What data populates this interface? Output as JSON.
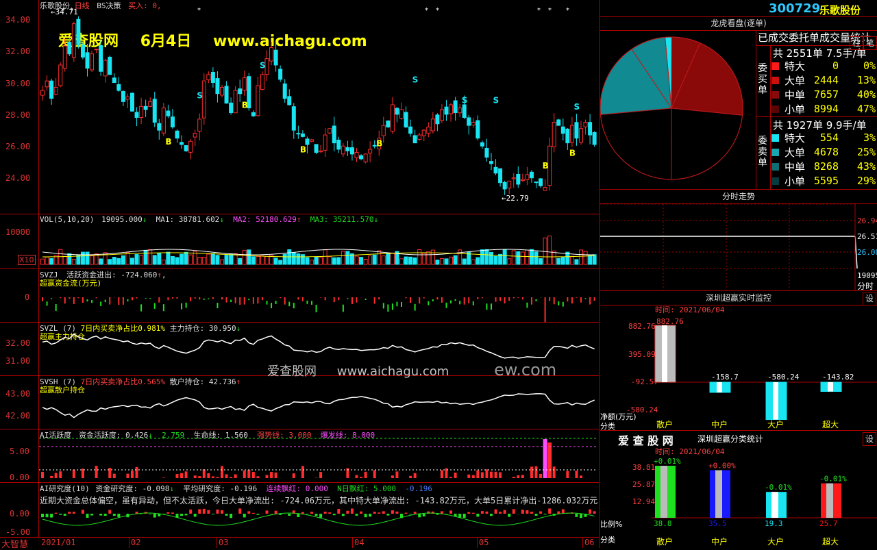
{
  "colors": {
    "up": "#ff2d2d",
    "down": "#18e4f2",
    "grid": "#a00000",
    "yellow": "#ffff00",
    "magenta": "#ff4dff",
    "green": "#1ee01e",
    "white": "#ffffff",
    "axisText": "#e03030"
  },
  "header": {
    "stock_name": "乐歌股份",
    "period": "日线",
    "strategy": "BS决策",
    "buy_label": "买入: 0,",
    "high_mark": "34.71",
    "low_mark": "22.79"
  },
  "watermark": {
    "site": "爱查股网",
    "date": "6月4日",
    "url": "www.aichagu.com",
    "center_site": "爱查股网",
    "center_url": "www.aichagu.com",
    "center_tail": "ew.com"
  },
  "price_axis": [
    "34.00",
    "32.00",
    "30.00",
    "28.00",
    "26.00",
    "24.00"
  ],
  "vol": {
    "label": "VOL(5,10,20)",
    "v": "19095.000",
    "ma1": "MA1: 38781.602",
    "ma2": "MA2: 52180.629",
    "ma3": "MA3: 35211.570",
    "axis": "10000",
    "unit": "X10"
  },
  "svzj": {
    "label": "SVZJ",
    "name": "活跃资金进出: -724.060",
    "sub": "超赢资金流(万元)",
    "axis": "0"
  },
  "svzl": {
    "label": "SVZL (7)",
    "pct": "7日内买卖净占比0.981%",
    "hold": "主力持仓: 30.950",
    "sub": "超赢主力持仓",
    "axis": [
      "32.00",
      "31.00"
    ]
  },
  "svsh": {
    "label": "SVSH (7)",
    "pct": "7日内买卖净占比0.565%",
    "hold": "散户持仓: 42.736",
    "sub": "超赢散户持仓",
    "axis": [
      "43.00",
      "42.00"
    ]
  },
  "ai1": {
    "label": "AI活跃度",
    "a": "资金活跃度: 0.426",
    "b": "2.759",
    "c": "生命线: 1.560",
    "d": "强势线: 3.000",
    "e": "爆发线: 8.000",
    "axis": [
      "5.00",
      "0.00"
    ]
  },
  "ai2": {
    "label": "AI研究度(10)",
    "a": "资金研究度: -0.098",
    "b": "平均研究度: -0.196",
    "c": "连续飘红: 0.000",
    "d": "N日飘红: 5.000",
    "e": "-0.196",
    "desc": "近期大资金总体偏空，虽有异动，但不太活跃，今日大单净流出: -724.06万元，其中特大单净流出: -143.82万元，大单5日累计净出-1286.032万元，当前主",
    "axis": [
      "0.00",
      "-5.00"
    ],
    "corner": "大智慧"
  },
  "dates": [
    "2021/01",
    "02",
    "03",
    "04",
    "05",
    "06"
  ],
  "right": {
    "code": "300729",
    "name": "乐歌股份",
    "pie_title": "龙虎看盘(逐单)",
    "stat_title": "已成交委托单成交量统计",
    "buy_label": "委买单",
    "sell_label": "委卖单",
    "buy_total": "共 2551单 7.5手/单",
    "sell_total": "共 1927单 9.9手/单",
    "buy_rows": [
      {
        "k": "特大",
        "n": "0",
        "p": "0%"
      },
      {
        "k": "大单",
        "n": "2444",
        "p": "13%"
      },
      {
        "k": "中单",
        "n": "7657",
        "p": "40%"
      },
      {
        "k": "小单",
        "n": "8994",
        "p": "47%"
      }
    ],
    "sell_rows": [
      {
        "k": "特大",
        "n": "554",
        "p": "3%"
      },
      {
        "k": "大单",
        "n": "4678",
        "p": "25%"
      },
      {
        "k": "中单",
        "n": "8268",
        "p": "43%"
      },
      {
        "k": "小单",
        "n": "5595",
        "p": "29%"
      }
    ],
    "btn_zhu": "柱",
    "btn_bi": "笔",
    "fenshi_title": "分时走势",
    "fenshi_axis": [
      "26.94",
      "26.51",
      "26.08",
      "19095"
    ],
    "fenshi_unit": "分时",
    "monitor_title": "深圳超赢实时监控",
    "time_label": "时间: 2021/06/04",
    "btn_set": "设",
    "monitor_axis": [
      "882.76",
      "395.09",
      "-92.57",
      "-580.24"
    ],
    "monitor_unit": "净额(万元)",
    "monitor_fenlei": "分类",
    "monitor_bars": [
      {
        "k": "散户",
        "v": "882.76",
        "val": 882.76
      },
      {
        "k": "中户",
        "v": "-158.7",
        "val": -158.7
      },
      {
        "k": "大户",
        "v": "-580.24",
        "val": -580.24
      },
      {
        "k": "超大",
        "v": "-143.82",
        "val": -143.82
      }
    ],
    "stat2_brand": "爱 查 股 网",
    "stat2_title": "深圳超赢分类统计",
    "time2_label": "时间: 2021/06/04",
    "stat2_axis": [
      "38.81",
      "25.87",
      "12.94",
      "0.00"
    ],
    "stat2_unit": "比例%",
    "stat2_fenlei": "分类",
    "stat2_bars": [
      {
        "k": "散户",
        "top": "+0.01%",
        "bot": "38.8",
        "val": 38.8
      },
      {
        "k": "中户",
        "top": "+0.00%",
        "bot": "35.5",
        "val": 35.5
      },
      {
        "k": "大户",
        "top": "-0.01%",
        "bot": "19.3",
        "val": 19.3
      },
      {
        "k": "超大",
        "top": "-0.01%",
        "bot": "25.7",
        "val": 25.7
      }
    ]
  }
}
